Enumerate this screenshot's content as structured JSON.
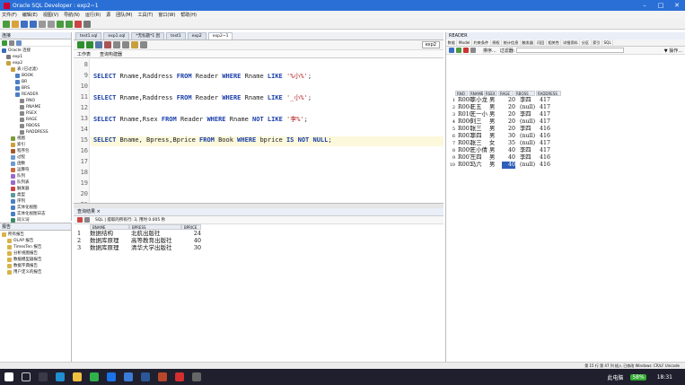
{
  "window": {
    "title": "Oracle SQL Developer : exp2~1",
    "min": "–",
    "max": "□",
    "close": "✕"
  },
  "menu": [
    "文件(F)",
    "编辑(E)",
    "视图(V)",
    "导航(N)",
    "运行(R)",
    "源",
    "团队(M)",
    "工具(T)",
    "窗口(W)",
    "帮助(H)"
  ],
  "connections": {
    "header": "连接",
    "items": [
      {
        "label": "Oracle 连接"
      },
      {
        "label": "exp1"
      },
      {
        "label": "exp2"
      },
      {
        "label": "表 (已过滤)"
      },
      {
        "label": "BOOK"
      },
      {
        "label": "BR"
      },
      {
        "label": "BRS"
      },
      {
        "label": "READER"
      },
      {
        "label": "RNO"
      },
      {
        "label": "RNAME"
      },
      {
        "label": "RSEX"
      },
      {
        "label": "RAGE"
      },
      {
        "label": "RBOSS"
      },
      {
        "label": "RADDRESS"
      },
      {
        "label": "视图"
      },
      {
        "label": "索引"
      },
      {
        "label": "程序包"
      },
      {
        "label": "过程"
      },
      {
        "label": "函数"
      },
      {
        "label": "运算符"
      },
      {
        "label": "队列"
      },
      {
        "label": "队列表"
      },
      {
        "label": "触发器"
      },
      {
        "label": "类型"
      },
      {
        "label": "序列"
      },
      {
        "label": "实体化视图"
      },
      {
        "label": "实体化视图日志"
      },
      {
        "label": "同义词"
      }
    ]
  },
  "reports": {
    "header": "报告",
    "items": [
      {
        "label": "所有报告"
      },
      {
        "label": "OLAP 报告"
      },
      {
        "label": "TimesTen 报告"
      },
      {
        "label": "分析视图报告"
      },
      {
        "label": "数据模型器报告"
      },
      {
        "label": "数据字典报告"
      },
      {
        "label": "用户定义的报告"
      }
    ]
  },
  "editor_tabs": [
    {
      "label": "test1.sql"
    },
    {
      "label": "exp1.sql"
    },
    {
      "label": "*无标题*1 因"
    },
    {
      "label": "test1"
    },
    {
      "label": "exp2"
    },
    {
      "label": "exp2~1"
    }
  ],
  "conn_select": "exp2",
  "subtabs": [
    "工作表",
    "查询构建器"
  ],
  "lines": [
    {
      "n": "8",
      "code": ""
    },
    {
      "n": "9",
      "code": "SELECT Rname,Raddress FROM Reader WHERE Rname LIKE '%小%';"
    },
    {
      "n": "10",
      "code": ""
    },
    {
      "n": "11",
      "code": "SELECT Rname,Raddress FROM Reader WHERE Rname LIKE '_小%';"
    },
    {
      "n": "12",
      "code": ""
    },
    {
      "n": "13",
      "code": "SELECT Rname,Rsex FROM Reader WHERE Rname NOT LIKE '李%';"
    },
    {
      "n": "14",
      "code": ""
    },
    {
      "n": "15",
      "code": "SELECT Bname, Bpress,Bprice FROM Book WHERE bprice IS NOT NULL;"
    },
    {
      "n": "16",
      "code": ""
    },
    {
      "n": "17",
      "code": ""
    },
    {
      "n": "18",
      "code": ""
    },
    {
      "n": "19",
      "code": ""
    },
    {
      "n": "20",
      "code": ""
    },
    {
      "n": "21",
      "code": ""
    }
  ],
  "results": {
    "tab": "查询结果 ×",
    "status": "SQL  |  提取的所有行: 3, 用时 0.005 秒",
    "columns": [
      "BNAME",
      "BPRESS",
      "BPRICE"
    ],
    "rows": [
      [
        "数据结构",
        "北航出版社",
        "24"
      ],
      [
        "数据库原理",
        "高等教育出版社",
        "40"
      ],
      [
        "数据库原理",
        "清华大学出版社",
        "30"
      ]
    ]
  },
  "reader": {
    "title": "READER",
    "tabs": [
      "数据",
      "Model",
      "约束条件",
      "授权",
      "统计信息",
      "触发器",
      "闪回",
      "相关性",
      "详细资料",
      "分区",
      "索引",
      "SQL"
    ],
    "sort_label": "排序...",
    "filter_label": "过滤器:",
    "actions_label": "▼ 操作...",
    "columns": [
      "RNO",
      "RNAME",
      "RSEX",
      "RAGE",
      "RBOSS",
      "RADDRESS"
    ],
    "rows": [
      {
        "i": "1",
        "rno": "R008",
        "name": "李小龙",
        "sex": "男",
        "age": "20",
        "boss": "李四",
        "addr": "417"
      },
      {
        "i": "2",
        "rno": "R004",
        "name": "王五",
        "sex": "男",
        "age": "20",
        "boss": "(null)",
        "addr": "417"
      },
      {
        "i": "3",
        "rno": "R010",
        "name": "王一小",
        "sex": "男",
        "age": "20",
        "boss": "李四",
        "addr": "417"
      },
      {
        "i": "4",
        "rno": "R006",
        "name": "刘三",
        "sex": "男",
        "age": "20",
        "boss": "(null)",
        "addr": "417"
      },
      {
        "i": "5",
        "rno": "R001",
        "name": "张三",
        "sex": "男",
        "age": "20",
        "boss": "李四",
        "addr": "416"
      },
      {
        "i": "6",
        "rno": "R003",
        "name": "李四",
        "sex": "男",
        "age": "30",
        "boss": "(null)",
        "addr": "416"
      },
      {
        "i": "7",
        "rno": "R002",
        "name": "张三",
        "sex": "女",
        "age": "35",
        "boss": "(null)",
        "addr": "417"
      },
      {
        "i": "8",
        "rno": "R009",
        "name": "王小倩",
        "sex": "男",
        "age": "40",
        "boss": "李四",
        "addr": "417"
      },
      {
        "i": "9",
        "rno": "R007",
        "name": "王四",
        "sex": "男",
        "age": "40",
        "boss": "李四",
        "addr": "416"
      },
      {
        "i": "10",
        "rno": "R005",
        "name": "马六",
        "sex": "男",
        "age": "40",
        "boss": "(null)",
        "addr": "416"
      }
    ]
  },
  "statusbar": "第 15 行 第 47 列   插入   已修改   Windows: CR/LF   Unicode",
  "tray": {
    "text": "此电脑",
    "battery": "58%",
    "time": "18:31"
  }
}
